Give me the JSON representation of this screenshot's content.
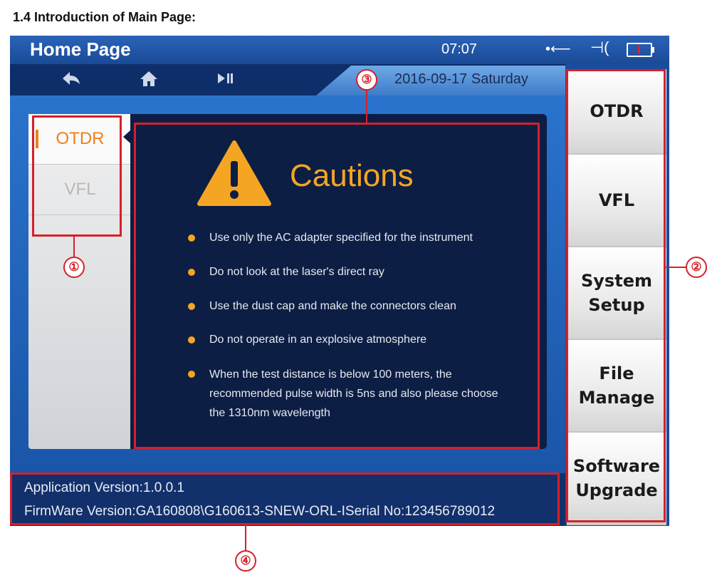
{
  "doc": {
    "heading": "1.4 Introduction of Main Page:"
  },
  "status_bar": {
    "title": "Home Page",
    "time": "07:07",
    "icons": [
      "usb-icon",
      "plug-icon",
      "battery-icon"
    ]
  },
  "nav": {
    "icons": [
      "back-arrow-icon",
      "home-icon",
      "play-pause-icon"
    ],
    "date": "2016-09-17 Saturday"
  },
  "left_tabs": {
    "items": [
      {
        "label": "OTDR",
        "active": true
      },
      {
        "label": "VFL",
        "active": false
      }
    ]
  },
  "cautions": {
    "title": "Cautions",
    "items": [
      "Use only the AC adapter specified for the instrument",
      "Do not look at the laser's direct ray",
      "Use the dust cap and make the connectors clean",
      "Do not operate in an explosive atmosphere",
      "When the test distance is below 100 meters, the recommended pulse width is 5ns and also please choose the 1310nm wavelength"
    ]
  },
  "right_menu": {
    "items": [
      "OTDR",
      "VFL",
      "System\nSetup",
      "File\nManage",
      "Software\nUpgrade"
    ]
  },
  "footer": {
    "app_version": "Application Version:1.0.0.1",
    "firmware_version": "FirmWare Version:GA160808\\G160613-SNEW-ORL-ISerial No:123456789012"
  },
  "callouts": [
    "①",
    "②",
    "③",
    "④"
  ],
  "colors": {
    "accent": "#f4a623",
    "highlight_tab": "#f07f18",
    "annotation_red": "#d5202b"
  }
}
